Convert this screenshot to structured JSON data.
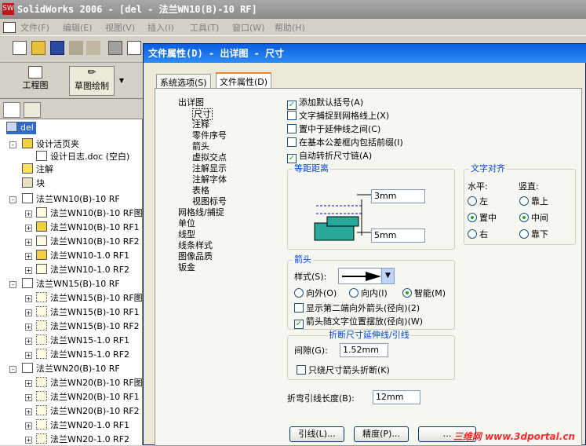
{
  "app": {
    "title": "SolidWorks 2006 - [del - 法兰WN10(B)-10 RF]",
    "logo": "SW"
  },
  "menu": [
    "文件(F)",
    "编辑(E)",
    "视图(V)",
    "插入(I)",
    "工具(T)",
    "窗口(W)",
    "帮助(H)"
  ],
  "toolbar2": {
    "drawing": "工程图",
    "sketch": "草图绘制"
  },
  "tree": {
    "root": "del",
    "items": [
      "设计活页夹",
      "设计日志.doc (空白)",
      "注解",
      "块",
      "法兰WN10(B)-10 RF",
      "法兰WN10(B)-10 RF图",
      "法兰WN10(B)-10 RF1",
      "法兰WN10(B)-10 RF2",
      "法兰WN10-1.0 RF1",
      "法兰WN10-1.0 RF2",
      "法兰WN15(B)-10 RF",
      "法兰WN15(B)-10 RF图",
      "法兰WN15(B)-10 RF1",
      "法兰WN15(B)-10 RF2",
      "法兰WN15-1.0 RF1",
      "法兰WN15-1.0 RF2",
      "法兰WN20(B)-10 RF",
      "法兰WN20(B)-10 RF图",
      "法兰WN20(B)-10 RF1",
      "法兰WN20(B)-10 RF2",
      "法兰WN20-1.0 RF1",
      "法兰WN20-1.0 RF2"
    ]
  },
  "dialog": {
    "title": "文件属性(D) - 出详图 - 尺寸",
    "tabs": [
      "系统选项(S)",
      "文件属性(D)"
    ],
    "proptree": [
      "出详图",
      "尺寸",
      "注释",
      "零件序号",
      "箭头",
      "虚拟交点",
      "注解显示",
      "注解字体",
      "表格",
      "视图标号",
      "网格线/捕捉",
      "单位",
      "线型",
      "线条样式",
      "图像品质",
      "钣金"
    ],
    "checks": [
      {
        "label": "添加默认括号(A)",
        "checked": true
      },
      {
        "label": "文字捕捉到网格线上(X)",
        "checked": false
      },
      {
        "label": "置中于延伸线之间(C)",
        "checked": false
      },
      {
        "label": "在基本公差框内包括前缀(I)",
        "checked": false
      },
      {
        "label": "自动转折尺寸链(A)",
        "checked": true
      }
    ],
    "offset": {
      "label": "等距距离",
      "v1": "3mm",
      "v2": "5mm"
    },
    "align": {
      "label": "文字对齐",
      "h": "水平:",
      "v": "竖直:",
      "left": "左",
      "center": "置中",
      "right": "右",
      "top": "靠上",
      "middle": "中间",
      "bottom": "靠下"
    },
    "arrows": {
      "label": "箭头",
      "style": "样式(S):",
      "out": "向外(O)",
      "in": "向内(I)",
      "smart": "智能(M)",
      "second": "显示第二端向外箭头(径向)(2)",
      "follow": "箭头随文字位置摆放(径向)(W)"
    },
    "break": {
      "label": "折断尺寸延伸线/引线",
      "gap": "间隙(G):",
      "gapval": "1.52mm",
      "only": "只绕尺寸箭头折断(K)"
    },
    "bent": {
      "label": "折弯引线长度(B):",
      "value": "12mm"
    },
    "buttons": {
      "leader": "引线(L)...",
      "precision": "精度(P)...",
      "third": "…"
    }
  },
  "watermark": "三维网 www.3dportal.cn"
}
